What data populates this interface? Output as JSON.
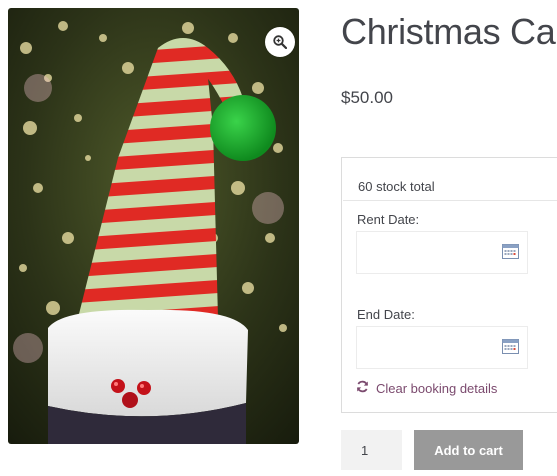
{
  "product": {
    "title": "Christmas Cap",
    "price": "$50.00",
    "image_alt": "Striped elf hat on a bokeh background"
  },
  "booking": {
    "stock_text": "60 stock total",
    "rent_date_label": "Rent Date:",
    "rent_date_value": "",
    "end_date_label": "End Date:",
    "end_date_value": "",
    "clear_label": "Clear booking details"
  },
  "cart": {
    "quantity": "1",
    "add_to_cart_label": "Add to cart"
  },
  "icons": {
    "zoom": "magnifier-zoom-icon",
    "calendar": "calendar-icon",
    "refresh": "refresh-icon"
  },
  "colors": {
    "link": "#7b4a6e",
    "button_bg": "#999999",
    "qty_bg": "#f2f2f2"
  }
}
